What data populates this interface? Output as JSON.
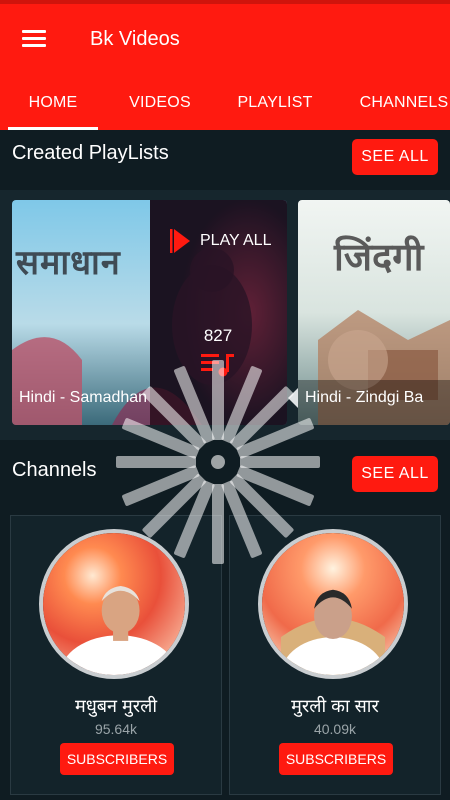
{
  "app": {
    "title": "Bk Videos"
  },
  "icons": {
    "menu": "hamburger-menu-icon",
    "play": "play-triangle-icon",
    "playlist": "playlist-music-icon",
    "loading": "loading-spinner-icon"
  },
  "colors": {
    "brand": "#ff1a10",
    "background": "#0f1c22"
  },
  "tabs": [
    {
      "label": "HOME",
      "active": true
    },
    {
      "label": "VIDEOS"
    },
    {
      "label": "PLAYLIST"
    },
    {
      "label": "CHANNELS"
    }
  ],
  "playlists": {
    "title": "Created PlayLists",
    "see_all": "SEE ALL",
    "play_all": "PLAY ALL",
    "count": "827",
    "items": [
      {
        "thumb_text": "समाधान",
        "label": "Hindi - Samadhan"
      },
      {
        "thumb_text": "जिंदगी",
        "label": "Hindi - Zindgi Ba"
      }
    ]
  },
  "channels": {
    "title": "Channels",
    "see_all": "SEE ALL",
    "items": [
      {
        "name": "मधुबन मुरली",
        "count": "95.64k",
        "button": "SUBSCRIBERS"
      },
      {
        "name": "मुरली का सार",
        "count": "40.09k",
        "button": "SUBSCRIBERS"
      }
    ]
  }
}
